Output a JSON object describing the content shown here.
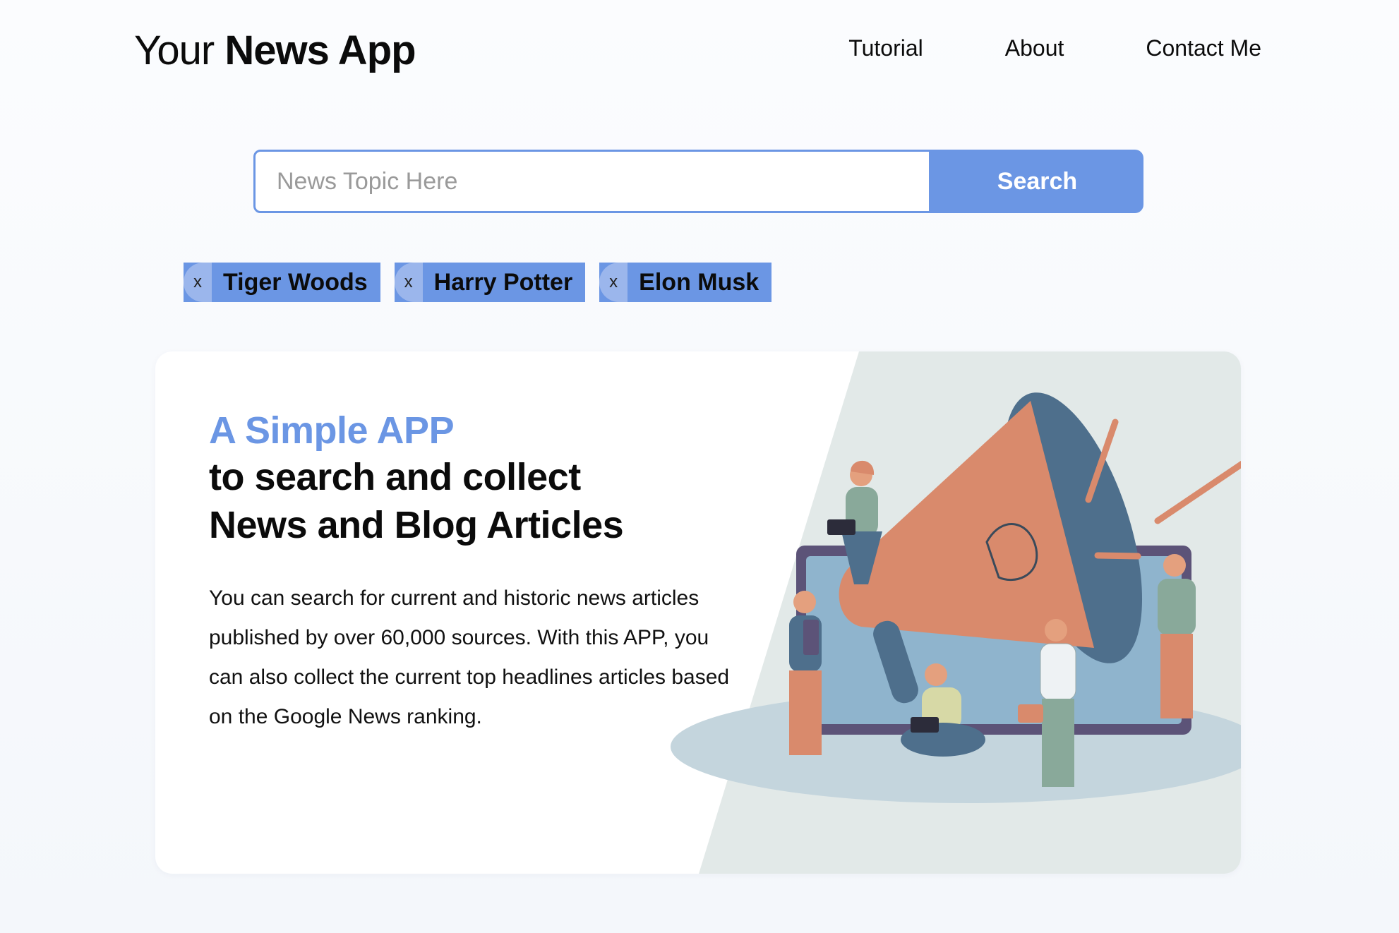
{
  "header": {
    "brand_light": "Your",
    "brand_bold": "News App",
    "nav": [
      "Tutorial",
      "About",
      "Contact Me"
    ]
  },
  "search": {
    "placeholder": "News Topic Here",
    "value": "",
    "button_label": "Search"
  },
  "chips": [
    {
      "remove": "x",
      "label": "Tiger Woods"
    },
    {
      "remove": "x",
      "label": "Harry Potter"
    },
    {
      "remove": "x",
      "label": "Elon Musk"
    }
  ],
  "hero": {
    "title": "A Simple APP",
    "subtitle_line1": "to search and collect",
    "subtitle_line2": "News and Blog Articles",
    "body": "You can search for current and historic news articles published by over 60,000 sources. With this APP, you can also collect the current top headlines articles based on the Google News ranking."
  },
  "colors": {
    "accent": "#6b96e4",
    "chip_remove_bg": "#9bb6ec",
    "illustration_bg": "#e2e9e8",
    "megaphone": "#d98a6c",
    "megaphone_bell": "#4e6f8c"
  },
  "illustration": {
    "icon": "megaphone-illustration"
  }
}
